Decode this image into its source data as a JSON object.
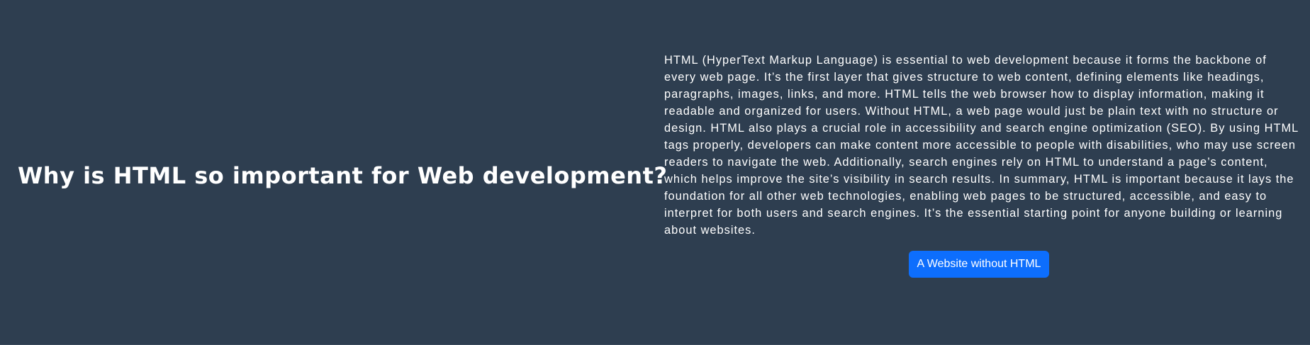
{
  "section": {
    "heading": "Why is HTML so important for Web development?",
    "paragraph": "HTML (HyperText Markup Language) is essential to web development because it forms the backbone of every web page. It’s the first layer that gives structure to web content, defining elements like headings, paragraphs, images, links, and more. HTML tells the web browser how to display information, making it readable and organized for users. Without HTML, a web page would just be plain text with no structure or design. HTML also plays a crucial role in accessibility and search engine optimization (SEO). By using HTML tags properly, developers can make content more accessible to people with disabilities, who may use screen readers to navigate the web. Additionally, search engines rely on HTML to understand a page’s content, which helps improve the site’s visibility in search results. In summary, HTML is important because it lays the foundation for all other web technologies, enabling web pages to be structured, accessible, and easy to interpret for both users and search engines. It’s the essential starting point for anyone building or learning about websites.",
    "button_label": "A Website without HTML"
  },
  "colors": {
    "background": "#2e3e50",
    "text": "#ffffff",
    "button": "#0d6efd"
  }
}
